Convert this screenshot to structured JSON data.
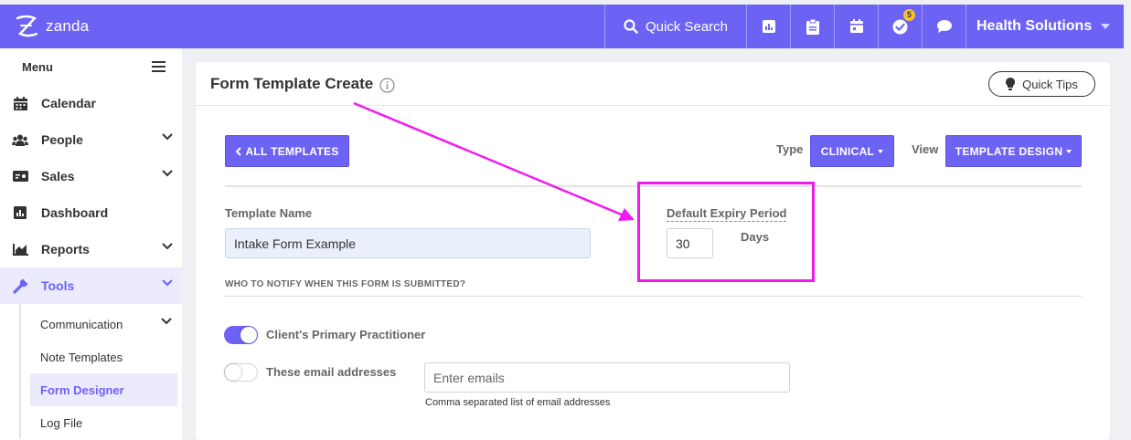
{
  "topbar": {
    "brand": "zanda",
    "search_label": "Quick Search",
    "notification_count": "5",
    "org_name": "Health Solutions",
    "icons": [
      "chart-icon",
      "clipboard-icon",
      "calendar-icon",
      "check-badge-icon",
      "chat-icon"
    ],
    "accent_color": "#6c63f5"
  },
  "sidebar": {
    "menu_label": "Menu",
    "items": [
      {
        "label": "Calendar",
        "icon": "calendar-icon"
      },
      {
        "label": "People",
        "icon": "people-icon"
      },
      {
        "label": "Sales",
        "icon": "sales-icon"
      },
      {
        "label": "Dashboard",
        "icon": "dashboard-icon"
      },
      {
        "label": "Reports",
        "icon": "reports-icon"
      },
      {
        "label": "Tools",
        "icon": "wrench-icon"
      }
    ],
    "sub_items": [
      {
        "label": "Communication"
      },
      {
        "label": "Note Templates"
      },
      {
        "label": "Form Designer"
      },
      {
        "label": "Log File"
      }
    ]
  },
  "page": {
    "title": "Form Template Create",
    "quick_tips": "Quick Tips",
    "all_templates": "ALL TEMPLATES",
    "type_label": "Type",
    "type_value": "CLINICAL",
    "view_label": "View",
    "view_value": "TEMPLATE DESIGN",
    "template_name_label": "Template Name",
    "template_name_value": "Intake Form Example",
    "expiry_label": "Default Expiry Period",
    "expiry_value": "30",
    "expiry_unit": "Days",
    "notify_heading": "WHO TO NOTIFY WHEN THIS FORM IS SUBMITTED?",
    "notify_practitioner": "Client's Primary Practitioner",
    "notify_practitioner_on": true,
    "notify_emails": "These email addresses",
    "notify_emails_on": false,
    "emails_placeholder": "Enter emails",
    "emails_help": "Comma separated list of email addresses"
  }
}
